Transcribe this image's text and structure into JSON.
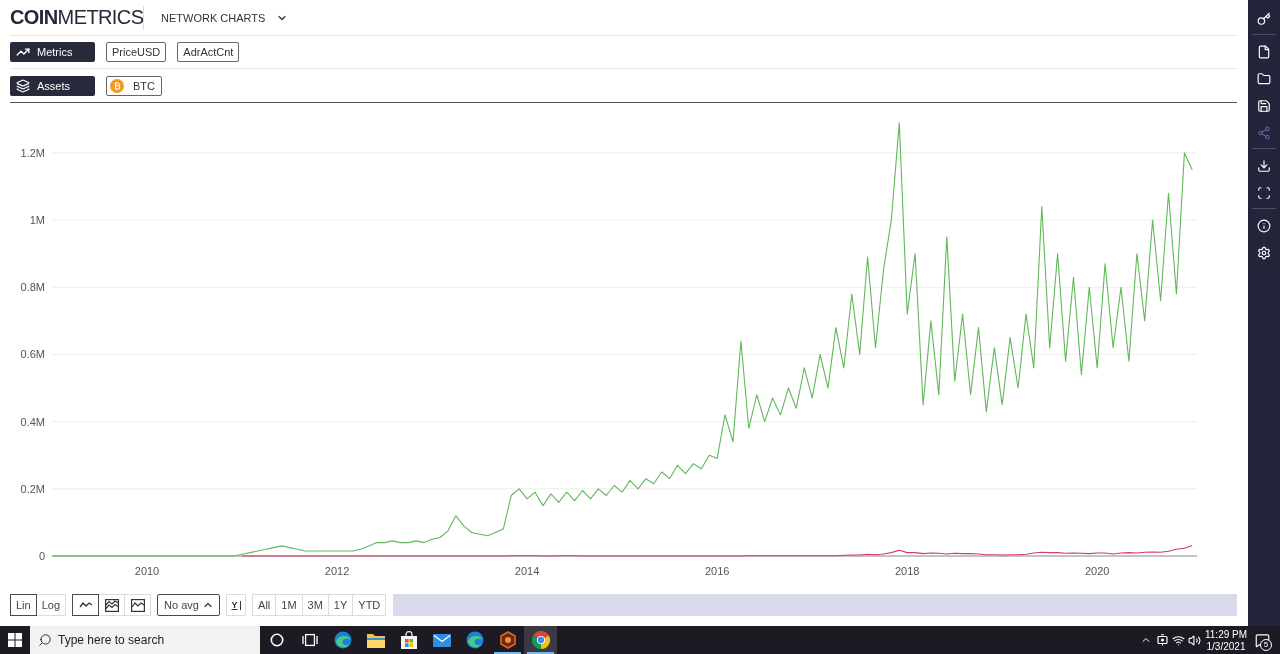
{
  "header": {
    "logo": "**COIN**METRICS",
    "nav_menu": {
      "label": "NETWORK CHARTS"
    }
  },
  "metrics": {
    "label": "Metrics"
  },
  "assets": {
    "label": "Assets",
    "chips": [
      {
        "label": "BTC"
      }
    ]
  },
  "chart": {
    "chart_data": {
      "type": "line",
      "grid": true,
      "x": [
        2009,
        2009.083,
        2009.167,
        2009.25,
        2009.333,
        2009.417,
        2009.5,
        2009.583,
        2009.667,
        2009.75,
        2009.833,
        2009.917,
        2010,
        2010.083,
        2010.167,
        2010.25,
        2010.333,
        2010.417,
        2010.5,
        2010.583,
        2010.667,
        2010.75,
        2010.833,
        2010.917,
        2011,
        2011.083,
        2011.167,
        2011.25,
        2011.333,
        2011.417,
        2011.5,
        2011.583,
        2011.667,
        2011.75,
        2011.833,
        2011.917,
        2012,
        2012.083,
        2012.167,
        2012.25,
        2012.333,
        2012.417,
        2012.5,
        2012.583,
        2012.667,
        2012.75,
        2012.833,
        2012.917,
        2013,
        2013.083,
        2013.167,
        2013.25,
        2013.333,
        2013.417,
        2013.5,
        2013.583,
        2013.667,
        2013.75,
        2013.833,
        2013.917,
        2014,
        2014.083,
        2014.167,
        2014.25,
        2014.333,
        2014.417,
        2014.5,
        2014.583,
        2014.667,
        2014.75,
        2014.833,
        2014.917,
        2015,
        2015.083,
        2015.167,
        2015.25,
        2015.333,
        2015.417,
        2015.5,
        2015.583,
        2015.667,
        2015.75,
        2015.833,
        2015.917,
        2016,
        2016.083,
        2016.167,
        2016.25,
        2016.333,
        2016.417,
        2016.5,
        2016.583,
        2016.667,
        2016.75,
        2016.833,
        2016.917,
        2017,
        2017.083,
        2017.167,
        2017.25,
        2017.333,
        2017.417,
        2017.5,
        2017.583,
        2017.667,
        2017.75,
        2017.833,
        2017.917,
        2018,
        2018.083,
        2018.167,
        2018.25,
        2018.333,
        2018.417,
        2018.5,
        2018.583,
        2018.667,
        2018.75,
        2018.833,
        2018.917,
        2019,
        2019.083,
        2019.167,
        2019.25,
        2019.333,
        2019.417,
        2019.5,
        2019.583,
        2019.667,
        2019.75,
        2019.833,
        2019.917,
        2020,
        2020.083,
        2020.167,
        2020.25,
        2020.333,
        2020.417,
        2020.5,
        2020.583,
        2020.667,
        2020.75,
        2020.833,
        2020.917,
        2021
      ],
      "series": [
        {
          "name": "PriceUSD",
          "color": "#d23c5e",
          "values": [
            null,
            null,
            null,
            null,
            null,
            null,
            null,
            null,
            null,
            null,
            null,
            null,
            null,
            null,
            null,
            null,
            null,
            null,
            null,
            null,
            null,
            null,
            null,
            null,
            0,
            0,
            0,
            0,
            0,
            0,
            0,
            0,
            0,
            0,
            0,
            0,
            0,
            0,
            0,
            0,
            0,
            0,
            0,
            0,
            0,
            0,
            0,
            0,
            0,
            0,
            0,
            0,
            0,
            0,
            0,
            0,
            0,
            0,
            1000,
            1000,
            1000,
            1000,
            0,
            0,
            1000,
            1000,
            1000,
            0,
            0,
            0,
            0,
            0,
            0,
            0,
            0,
            0,
            0,
            0,
            0,
            0,
            0,
            0,
            0,
            0,
            0,
            0,
            0,
            0,
            1000,
            1000,
            1000,
            1000,
            1000,
            1000,
            1000,
            1000,
            1000,
            1000,
            1000,
            1000,
            2000,
            3000,
            3000,
            5000,
            4000,
            6000,
            10000,
            17000,
            10000,
            10000,
            7000,
            9000,
            8000,
            6000,
            8000,
            7000,
            7000,
            6000,
            4000,
            4000,
            3000,
            4000,
            4000,
            5000,
            9000,
            11000,
            10000,
            10000,
            8000,
            9000,
            8000,
            7000,
            9000,
            9000,
            6000,
            9000,
            10000,
            9000,
            11000,
            12000,
            11000,
            14000,
            20000,
            23000,
            31000
          ]
        },
        {
          "name": "AdrActCnt",
          "color": "#62b85a",
          "values": [
            0,
            0,
            0,
            0,
            0,
            0,
            0,
            0,
            0,
            0,
            0,
            0,
            0,
            0,
            0,
            0,
            0,
            0,
            0,
            0,
            0,
            0,
            0,
            0,
            5000,
            10000,
            15000,
            20000,
            25000,
            30000,
            25000,
            20000,
            15000,
            15000,
            15000,
            15000,
            15000,
            15000,
            15000,
            20000,
            30000,
            40000,
            40000,
            45000,
            40000,
            40000,
            45000,
            40000,
            50000,
            55000,
            75000,
            120000,
            90000,
            70000,
            65000,
            60000,
            70000,
            80000,
            180000,
            200000,
            170000,
            190000,
            150000,
            185000,
            160000,
            190000,
            165000,
            195000,
            170000,
            200000,
            180000,
            210000,
            190000,
            225000,
            200000,
            230000,
            215000,
            250000,
            230000,
            270000,
            245000,
            275000,
            260000,
            300000,
            290000,
            420000,
            340000,
            640000,
            380000,
            480000,
            400000,
            470000,
            420000,
            500000,
            440000,
            560000,
            470000,
            600000,
            500000,
            680000,
            560000,
            780000,
            600000,
            890000,
            620000,
            850000,
            1000000,
            1290000,
            720000,
            900000,
            450000,
            700000,
            480000,
            950000,
            520000,
            720000,
            480000,
            680000,
            430000,
            620000,
            450000,
            650000,
            500000,
            720000,
            560000,
            1040000,
            620000,
            900000,
            580000,
            830000,
            540000,
            800000,
            560000,
            870000,
            620000,
            800000,
            580000,
            900000,
            700000,
            1000000,
            760000,
            1080000,
            780000,
            1200000,
            1150000
          ]
        }
      ],
      "xlim": [
        2009,
        2021.05
      ],
      "ylim": [
        0,
        1350000
      ],
      "xticks": [
        {
          "value": 2010,
          "label": "2010"
        },
        {
          "value": 2012,
          "label": "2012"
        },
        {
          "value": 2014,
          "label": "2014"
        },
        {
          "value": 2016,
          "label": "2016"
        },
        {
          "value": 2018,
          "label": "2018"
        },
        {
          "value": 2020,
          "label": "2020"
        }
      ],
      "yticks": [
        {
          "value": 0,
          "label": "0"
        },
        {
          "value": 200000,
          "label": "0.2M"
        },
        {
          "value": 400000,
          "label": "0.4M"
        },
        {
          "value": 600000,
          "label": "0.6M"
        },
        {
          "value": 800000,
          "label": "0.8M"
        },
        {
          "value": 1000000,
          "label": "1M"
        },
        {
          "value": 1200000,
          "label": "1.2M"
        }
      ]
    }
  },
  "toolbar": {
    "scales": [
      {
        "label": "Lin",
        "selected": true
      },
      {
        "label": "Log",
        "selected": false
      }
    ],
    "chart_types": [
      {
        "kind": "line",
        "selected": true
      },
      {
        "kind": "multi_area",
        "selected": false
      },
      {
        "kind": "area",
        "selected": false
      }
    ],
    "average": {
      "value": "No avg"
    },
    "axis_toggle": {
      "label": "Y"
    },
    "ranges": [
      {
        "label": "All",
        "selected": false
      },
      {
        "label": "1M",
        "selected": false
      },
      {
        "label": "3M",
        "selected": false
      },
      {
        "label": "1Y",
        "selected": false
      },
      {
        "label": "YTD",
        "selected": false
      }
    ]
  },
  "sidebar": {
    "groups": [
      {
        "items": [
          {
            "kind": "key",
            "disabled": false
          }
        ]
      },
      {
        "items": [
          {
            "kind": "file",
            "disabled": false
          },
          {
            "kind": "folder",
            "disabled": false
          },
          {
            "kind": "save",
            "disabled": false
          },
          {
            "kind": "share",
            "disabled": true
          }
        ]
      },
      {
        "items": [
          {
            "kind": "download",
            "disabled": false
          },
          {
            "kind": "fullscreen",
            "disabled": false
          }
        ]
      },
      {
        "items": [
          {
            "kind": "info",
            "disabled": false
          },
          {
            "kind": "settings",
            "disabled": false
          }
        ]
      }
    ]
  },
  "taskbar": {
    "search": {
      "placeholder": "Type here to search"
    },
    "apps": [
      {
        "kind": "cortana",
        "running": false,
        "selected": false
      },
      {
        "kind": "task_view",
        "running": false,
        "selected": false
      },
      {
        "kind": "edge",
        "running": false,
        "selected": false
      },
      {
        "kind": "explorer",
        "running": false,
        "selected": false
      },
      {
        "kind": "store",
        "running": false,
        "selected": false
      },
      {
        "kind": "mail",
        "running": false,
        "selected": false
      },
      {
        "kind": "edge",
        "running": false,
        "selected": false
      },
      {
        "kind": "hexagon",
        "running": true,
        "selected": false
      },
      {
        "kind": "chrome",
        "running": true,
        "selected": true
      }
    ],
    "clock": {
      "time": "11:29 PM",
      "date": "1/3/2021"
    },
    "notifications": {
      "count": "5"
    }
  }
}
